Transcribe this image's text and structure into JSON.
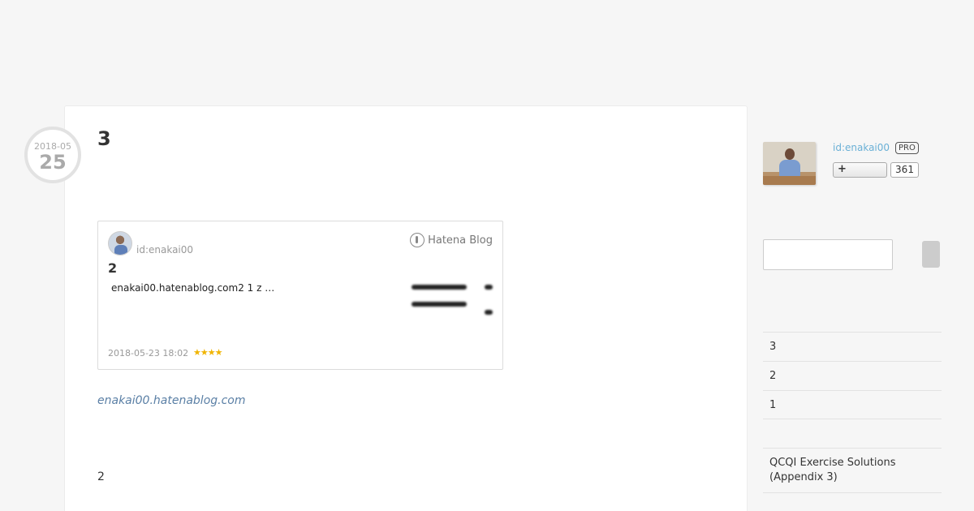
{
  "entry": {
    "date_ym": "2018-05",
    "date_day": "25",
    "title": "3",
    "link_text": "enakai00.hatenablog.com",
    "paragraph": "2"
  },
  "embed": {
    "user": "id:enakai00",
    "logo_text": "Hatena Blog",
    "title": "2",
    "description": "enakai00.hatenablog.com2 1 z …",
    "date": "2018-05-23 18:02",
    "stars": "★★★★"
  },
  "sidebar": {
    "profile_id": "id:enakai00",
    "pro_badge": "PRO",
    "follow_icon": "+",
    "follow_count": "361",
    "recent_items": [
      "3",
      "2",
      "1"
    ],
    "category_items": [
      "QCQI Exercise Solutions (Appendix 3)"
    ]
  },
  "colors": {
    "link": "#5a7fa5",
    "profile_id": "#6ab0d6",
    "star": "#f0b400"
  }
}
